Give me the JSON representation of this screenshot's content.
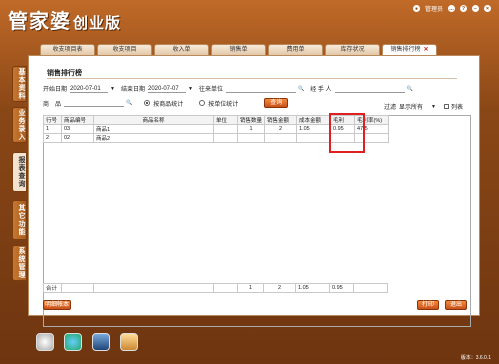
{
  "app": {
    "title": "管家婆",
    "edition": "创业版",
    "version": "版本：3.6.0.1"
  },
  "header": {
    "user_label": "管理员",
    "user_icon": "user-icon",
    "actions": [
      "chat-icon",
      "help-icon",
      "minimize-icon",
      "close-icon"
    ]
  },
  "tabs": [
    {
      "label": "收支项目表"
    },
    {
      "label": "收支项目"
    },
    {
      "label": "收入单"
    },
    {
      "label": "销售单"
    },
    {
      "label": "费用单"
    },
    {
      "label": "库存状况"
    },
    {
      "label": "销售排行榜",
      "active": true
    }
  ],
  "sidebar": [
    {
      "label": "基本资料"
    },
    {
      "label": "业务录入"
    },
    {
      "label": "报表查询",
      "active": true
    },
    {
      "label": "其它功能"
    },
    {
      "label": "系统管理"
    }
  ],
  "panel": {
    "title": "销售排行榜",
    "start_date_label": "开始日期",
    "start_date": "2020-07-01",
    "end_date_label": "结束日期",
    "end_date": "2020-07-07",
    "unit_label": "往来单位",
    "handler_label": "经 手 人",
    "product_label": "商　品",
    "radio_by_product": "按商品统计",
    "radio_by_unit": "按单位统计",
    "query_button": "查询",
    "filter_label": "过滤",
    "filter_value": "显示所有",
    "column_label": "列表"
  },
  "table": {
    "columns": [
      "行号",
      "商品编号",
      "商品名称",
      "单位",
      "销售数量",
      "销售金额",
      "成本金额",
      "毛利",
      "毛利率(%)"
    ],
    "rows": [
      [
        "1",
        "03",
        "商品1",
        "",
        "1",
        "2",
        "1.05",
        "0.95",
        "47.5"
      ],
      [
        "2",
        "02",
        "商品2",
        "",
        "",
        "",
        "",
        "",
        ""
      ]
    ],
    "totals": [
      "合计",
      "",
      "",
      "",
      "1",
      "2",
      "1.05",
      "0.95",
      ""
    ]
  },
  "footer": {
    "detail_button": "明细帐本",
    "print_button": "打印",
    "exit_button": "退出"
  }
}
